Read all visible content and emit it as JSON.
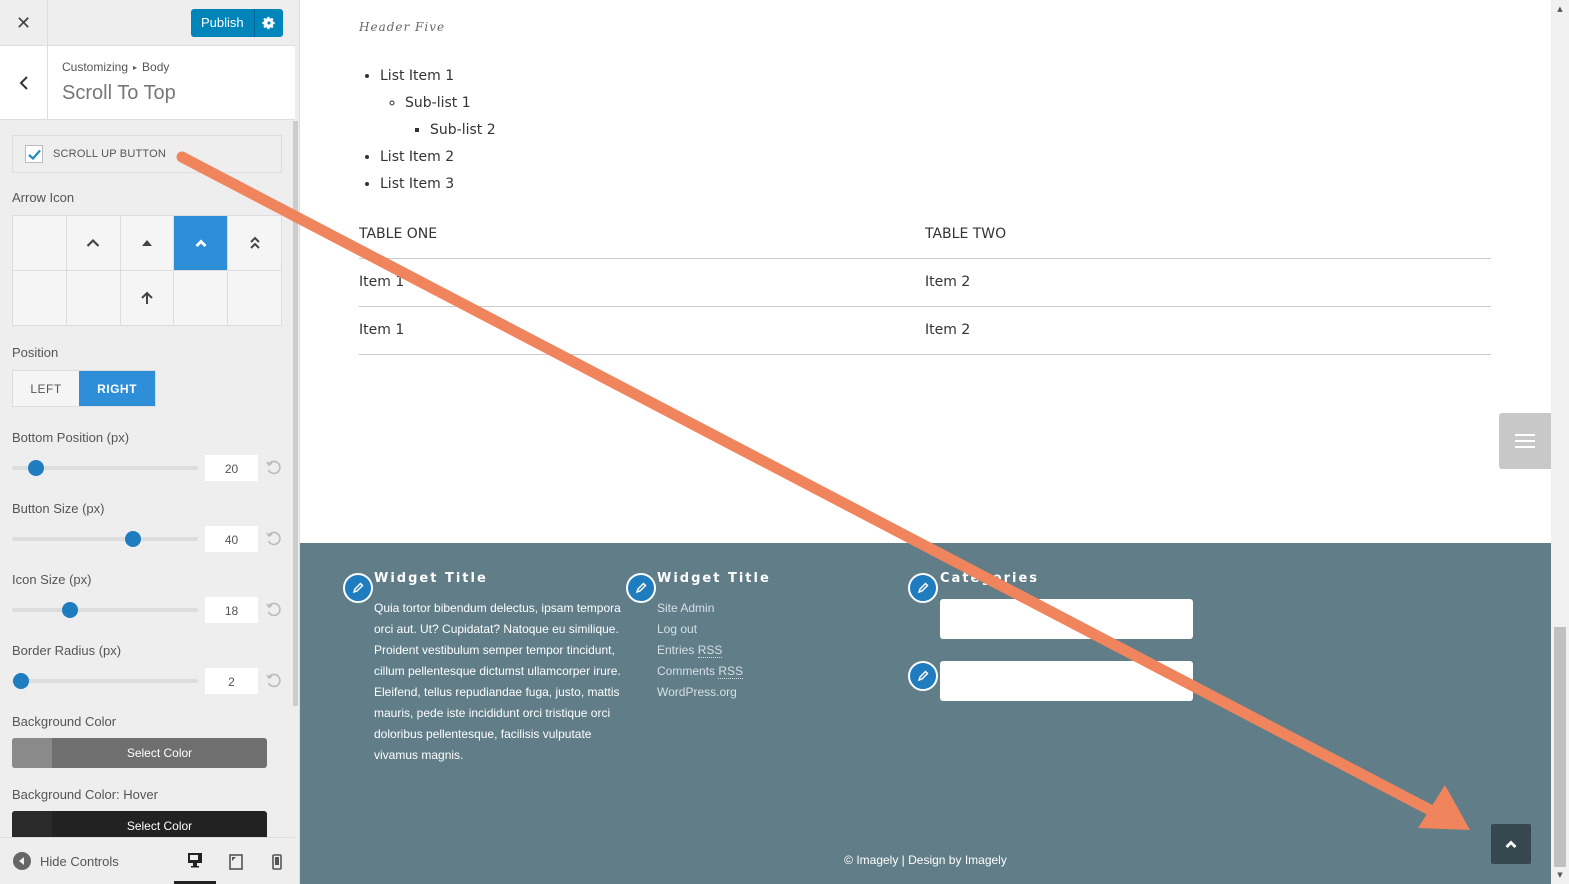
{
  "header": {
    "close_icon": "close-icon",
    "publish_label": "Publish",
    "settings_icon": "gear-icon"
  },
  "section": {
    "breadcrumb_root": "Customizing",
    "breadcrumb_separator": "▸",
    "breadcrumb_parent": "Body",
    "title": "Scroll To Top"
  },
  "controls": {
    "scroll_up_button": {
      "label": "SCROLL UP BUTTON",
      "checked": true
    },
    "arrow_icon": {
      "label": "Arrow Icon",
      "options": [
        "none",
        "chevron-up",
        "triangle-up",
        "chevron-up-bold",
        "double-chevron-up",
        "none",
        "none",
        "arrow-up",
        "none",
        "none"
      ],
      "selected_index": 3
    },
    "position": {
      "label": "Position",
      "options": [
        "LEFT",
        "RIGHT"
      ],
      "selected": "RIGHT"
    },
    "sliders": [
      {
        "label": "Bottom Position (px)",
        "value": "20",
        "fraction": 0.13
      },
      {
        "label": "Button Size (px)",
        "value": "40",
        "fraction": 0.65
      },
      {
        "label": "Icon Size (px)",
        "value": "18",
        "fraction": 0.31
      },
      {
        "label": "Border Radius (px)",
        "value": "2",
        "fraction": 0.05
      }
    ],
    "background_color": {
      "label": "Background Color",
      "button_label": "Select Color",
      "color": "#777777"
    },
    "background_color_hover": {
      "label": "Background Color: Hover",
      "button_label": "Select Color",
      "color": "#222222"
    }
  },
  "footer_bar": {
    "hide_controls_label": "Hide Controls",
    "devices": [
      "desktop",
      "tablet",
      "mobile"
    ],
    "active_device": "desktop"
  },
  "preview": {
    "header_five": "Header Five",
    "list": {
      "item1": "List Item 1",
      "sub1": "Sub-list 1",
      "sub2": "Sub-list 2",
      "item2": "List Item 2",
      "item3": "List Item 3"
    },
    "table": {
      "headers": [
        "TABLE ONE",
        "TABLE TWO"
      ],
      "rows": [
        [
          "Item 1",
          "Item 2"
        ],
        [
          "Item 1",
          "Item 2"
        ]
      ]
    },
    "widgets": [
      {
        "title": "Widget Title",
        "text": "Quia tortor bibendum delectus, ipsam tempora orci aut. Ut? Cupidatat? Natoque eu similique. Proident vestibulum semper tempor tincidunt, cillum pellentesque dictumst ullamcorper irure. Eleifend, tellus repudiandae fuga, justo, mattis mauris, pede iste incididunt orci tristique orci doloribus pellentesque, facilisis vulputate vivamus magnis."
      },
      {
        "title": "Widget Title",
        "links": [
          "Site Admin",
          "Log out",
          "Entries",
          "Comments",
          "WordPress.org"
        ],
        "rss": "RSS"
      },
      {
        "title": "Categories"
      }
    ],
    "copyright": "© Imagely | Design by Imagely"
  },
  "colors": {
    "accent": "#2e8fd8",
    "publish": "#0085ba",
    "footer_bg": "#607d88",
    "scroll_top_bg": "#37474f",
    "annotation_arrow": "#f0845c"
  }
}
